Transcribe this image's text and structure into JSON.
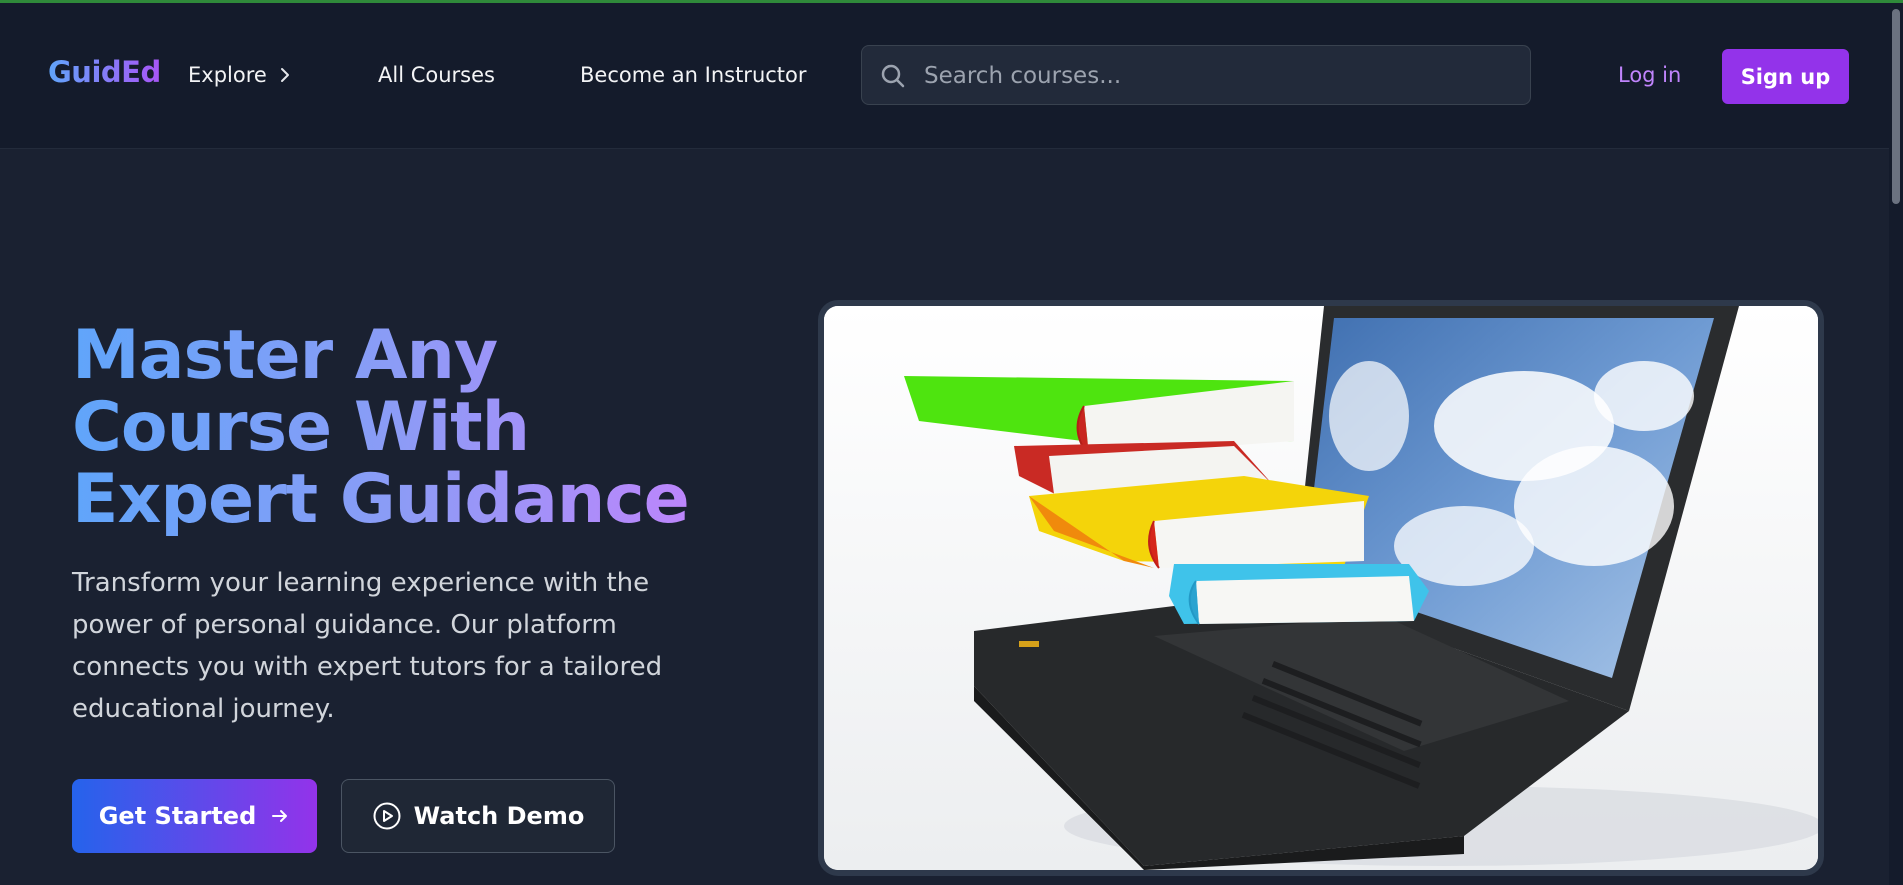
{
  "nav": {
    "logo": "GuidEd",
    "explore": "Explore",
    "all_courses": "All Courses",
    "become_instructor": "Become an Instructor",
    "search_placeholder": "Search courses...",
    "login": "Log in",
    "signup": "Sign up"
  },
  "hero": {
    "title_line1": "Master Any",
    "title_line2": "Course With",
    "title_line3": "Expert Guidance",
    "subtitle": "Transform your learning experience with the power of personal guidance. Our platform connects you with expert tutors for a tailored educational journey.",
    "primary_cta": "Get Started",
    "secondary_cta": "Watch Demo"
  },
  "colors": {
    "background": "#1a2131",
    "navbar": "#141b2b",
    "accent_purple": "#9333ea",
    "accent_blue": "#2563eb",
    "link_purple": "#c084fc"
  },
  "icons": [
    "chevron-right-icon",
    "search-icon",
    "arrow-right-icon",
    "play-circle-icon"
  ]
}
